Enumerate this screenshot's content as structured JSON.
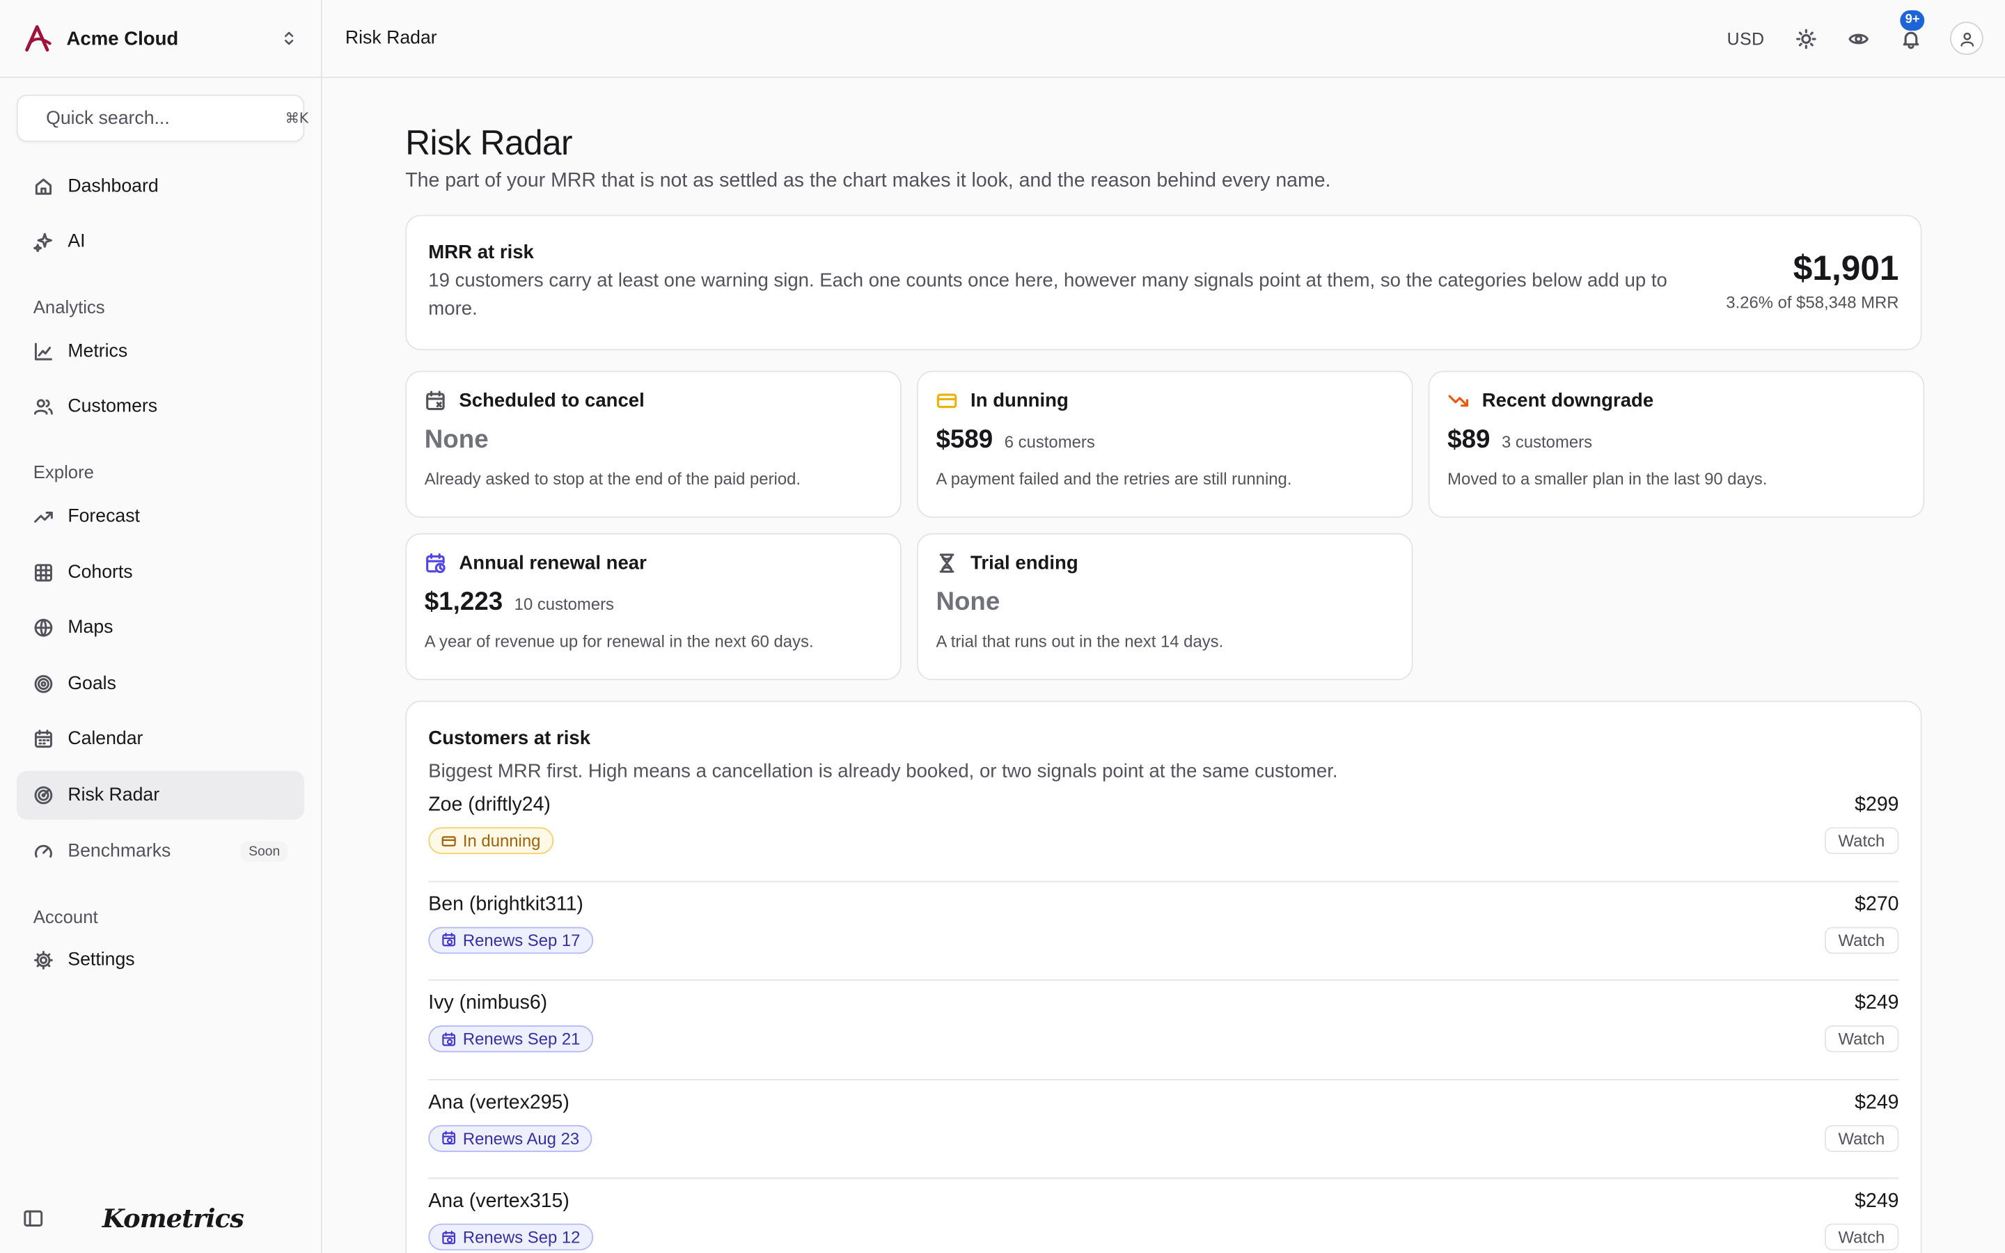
{
  "org": {
    "name": "Acme Cloud"
  },
  "search": {
    "placeholder": "Quick search...",
    "shortcut": "⌘K"
  },
  "nav": {
    "top": [
      {
        "label": "Dashboard",
        "icon": "home-icon"
      },
      {
        "label": "AI",
        "icon": "sparkles-icon"
      }
    ],
    "analytics_label": "Analytics",
    "analytics": [
      {
        "label": "Metrics",
        "icon": "line-chart-icon"
      },
      {
        "label": "Customers",
        "icon": "users-icon"
      }
    ],
    "explore_label": "Explore",
    "explore": [
      {
        "label": "Forecast",
        "icon": "trending-up-icon"
      },
      {
        "label": "Cohorts",
        "icon": "grid-icon"
      },
      {
        "label": "Maps",
        "icon": "globe-icon"
      },
      {
        "label": "Goals",
        "icon": "target-icon"
      },
      {
        "label": "Calendar",
        "icon": "calendar-icon"
      },
      {
        "label": "Risk Radar",
        "icon": "radar-icon",
        "active": true
      },
      {
        "label": "Benchmarks",
        "icon": "gauge-icon",
        "badge": "Soon"
      }
    ],
    "account_label": "Account",
    "account": [
      {
        "label": "Settings",
        "icon": "gear-icon"
      }
    ]
  },
  "footer": {
    "brand": "Kometrics"
  },
  "topbar": {
    "breadcrumb": "Risk Radar",
    "currency": "USD",
    "notifications_badge": "9+"
  },
  "page": {
    "title": "Risk Radar",
    "subtitle": "The part of your MRR that is not as settled as the chart makes it look, and the reason behind every name."
  },
  "summary": {
    "title": "MRR at risk",
    "description": "19 customers carry at least one warning sign. Each one counts once here, however many signals point at them, so the categories below add up to more.",
    "value": "$1,901",
    "note": "3.26% of $58,348 MRR"
  },
  "categories": [
    {
      "title": "Scheduled to cancel",
      "icon": "calendar-x-icon",
      "icon_color": "#52525b",
      "value": "None",
      "count": "",
      "description": "Already asked to stop at the end of the paid period."
    },
    {
      "title": "In dunning",
      "icon": "credit-card-icon",
      "icon_color": "#eab308",
      "value": "$589",
      "count": "6 customers",
      "description": "A payment failed and the retries are still running."
    },
    {
      "title": "Recent downgrade",
      "icon": "trending-down-icon",
      "icon_color": "#ea580c",
      "value": "$89",
      "count": "3 customers",
      "description": "Moved to a smaller plan in the last 90 days."
    },
    {
      "title": "Annual renewal near",
      "icon": "calendar-clock-icon",
      "icon_color": "#4f46e5",
      "value": "$1,223",
      "count": "10 customers",
      "description": "A year of revenue up for renewal in the next 60 days."
    },
    {
      "title": "Trial ending",
      "icon": "hourglass-icon",
      "icon_color": "#52525b",
      "value": "None",
      "count": "",
      "description": "A trial that runs out in the next 14 days."
    }
  ],
  "at_risk": {
    "title": "Customers at risk",
    "description": "Biggest MRR first. High means a cancellation is already booked, or two signals point at the same customer.",
    "rows": [
      {
        "name": "Zoe (driftly24)",
        "amount": "$299",
        "tag": "In dunning",
        "tag_kind": "amber",
        "action": "Watch"
      },
      {
        "name": "Ben (brightkit311)",
        "amount": "$270",
        "tag": "Renews Sep 17",
        "tag_kind": "indigo",
        "action": "Watch"
      },
      {
        "name": "Ivy (nimbus6)",
        "amount": "$249",
        "tag": "Renews Sep 21",
        "tag_kind": "indigo",
        "action": "Watch"
      },
      {
        "name": "Ana (vertex295)",
        "amount": "$249",
        "tag": "Renews Aug 23",
        "tag_kind": "indigo",
        "action": "Watch"
      },
      {
        "name": "Ana (vertex315)",
        "amount": "$249",
        "tag": "Renews Sep 12",
        "tag_kind": "indigo",
        "action": "Watch"
      }
    ]
  }
}
